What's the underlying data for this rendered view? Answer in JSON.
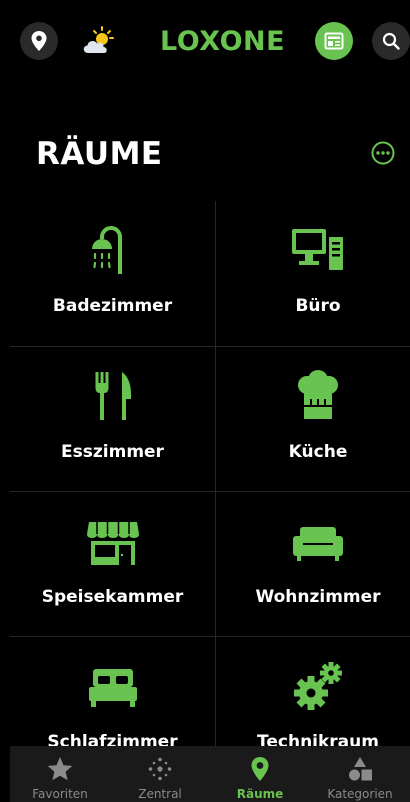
{
  "header": {
    "logo": "LOXONE",
    "location_icon": "map-pin-icon",
    "weather_icon": "partly-sunny-icon",
    "news_icon": "newspaper-icon",
    "search_icon": "search-icon"
  },
  "page": {
    "title": "RÄUME",
    "more_icon": "more-options-icon"
  },
  "rooms": [
    {
      "label": "Badezimmer",
      "icon": "shower-icon"
    },
    {
      "label": "Büro",
      "icon": "computer-icon"
    },
    {
      "label": "Esszimmer",
      "icon": "cutlery-icon"
    },
    {
      "label": "Küche",
      "icon": "chef-hat-icon"
    },
    {
      "label": "Speisekammer",
      "icon": "pantry-shop-icon"
    },
    {
      "label": "Wohnzimmer",
      "icon": "sofa-icon"
    },
    {
      "label": "Schlafzimmer",
      "icon": "bed-icon"
    },
    {
      "label": "Technikraum",
      "icon": "gears-icon"
    }
  ],
  "tabs": [
    {
      "label": "Favoriten",
      "icon": "star-icon",
      "active": false
    },
    {
      "label": "Zentral",
      "icon": "central-dots-icon",
      "active": false
    },
    {
      "label": "Räume",
      "icon": "map-pin-icon",
      "active": true
    },
    {
      "label": "Kategorien",
      "icon": "categories-icon",
      "active": false
    }
  ],
  "colors": {
    "accent": "#69c350",
    "background": "#000000",
    "tabbar": "#1a1a1a",
    "inactive": "#8a8a8a"
  }
}
